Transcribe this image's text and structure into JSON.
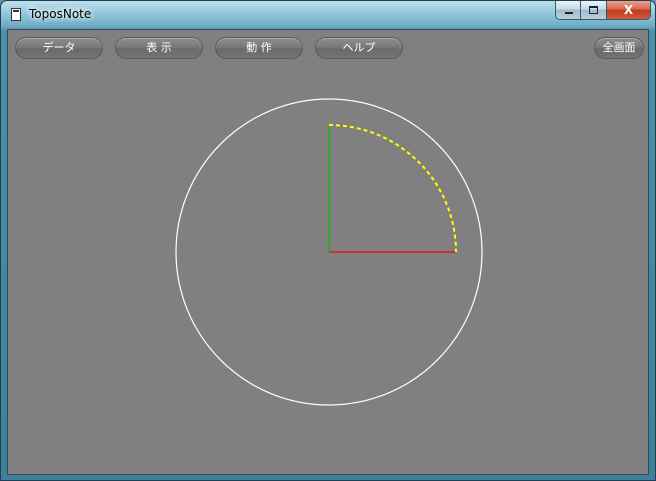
{
  "window": {
    "title": "ToposNote",
    "close_glyph": "X"
  },
  "toolbar": {
    "data_label": "データ",
    "view_label": "表 示",
    "action_label": "動 作",
    "help_label": "ヘルプ",
    "fullscreen_label": "全画面"
  },
  "colors": {
    "canvas_bg": "#808080",
    "circle": "#ffffff",
    "x_axis": "#ff0000",
    "y_axis": "#00c000",
    "arc": "#ffff00"
  },
  "icons": [
    "app-document-icon",
    "minimize-icon",
    "maximize-icon",
    "close-icon"
  ]
}
